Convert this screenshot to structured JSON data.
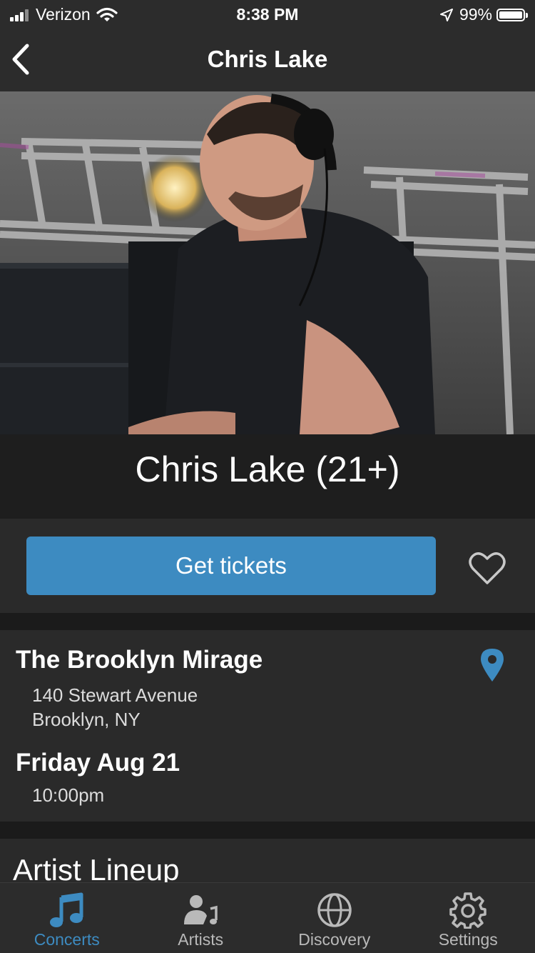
{
  "status_bar": {
    "carrier": "Verizon",
    "time": "8:38 PM",
    "battery": "99%",
    "battery_level": 0.99
  },
  "nav": {
    "title": "Chris Lake",
    "back_icon": "chevron-left-icon"
  },
  "hero": {
    "image_subject": "DJ wearing headphones at stage"
  },
  "event": {
    "title": "Chris Lake (21+)"
  },
  "tickets": {
    "button_label": "Get tickets",
    "favorite_icon": "heart-outline-icon"
  },
  "venue": {
    "name": "The Brooklyn Mirage",
    "address_line1": "140 Stewart Avenue",
    "address_line2": "Brooklyn, NY",
    "pin_icon": "map-pin-icon"
  },
  "schedule": {
    "date": "Friday Aug 21",
    "time": "10:00pm"
  },
  "lineup": {
    "heading": "Artist Lineup"
  },
  "tabs": [
    {
      "label": "Concerts",
      "icon": "music-note-icon",
      "active": true
    },
    {
      "label": "Artists",
      "icon": "artist-icon",
      "active": false
    },
    {
      "label": "Discovery",
      "icon": "globe-icon",
      "active": false
    },
    {
      "label": "Settings",
      "icon": "gear-icon",
      "active": false
    }
  ],
  "colors": {
    "accent": "#3d8bc1",
    "background": "#1b1b1b",
    "panel": "#2a2a2a",
    "bar": "#2c2c2c"
  }
}
